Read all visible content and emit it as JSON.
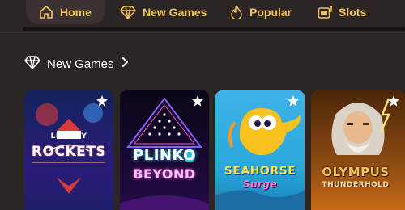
{
  "nav": {
    "items": [
      {
        "label": "Home",
        "icon": "home-icon"
      },
      {
        "label": "New Games",
        "icon": "diamond-icon"
      },
      {
        "label": "Popular",
        "icon": "flame-icon"
      },
      {
        "label": "Slots",
        "icon": "slot-machine-icon"
      }
    ],
    "active": "Home",
    "accent_color": "#f5c35a"
  },
  "section": {
    "title": "New Games",
    "icon": "diamond-icon",
    "more_icon": "chevron-right-icon"
  },
  "games": [
    {
      "title_line1": "LIBERTY",
      "title_line2": "ROCKETS",
      "favorite_icon": "star-icon"
    },
    {
      "title_line1": "PLINKO",
      "title_line2": "BEYOND",
      "favorite_icon": "star-icon"
    },
    {
      "title_line1": "SEAHORSE",
      "title_line2": "Surge",
      "favorite_icon": "star-icon"
    },
    {
      "title_line1": "OLYMPUS",
      "title_line2": "THUNDERHOLD",
      "favorite_icon": "star-icon"
    }
  ]
}
